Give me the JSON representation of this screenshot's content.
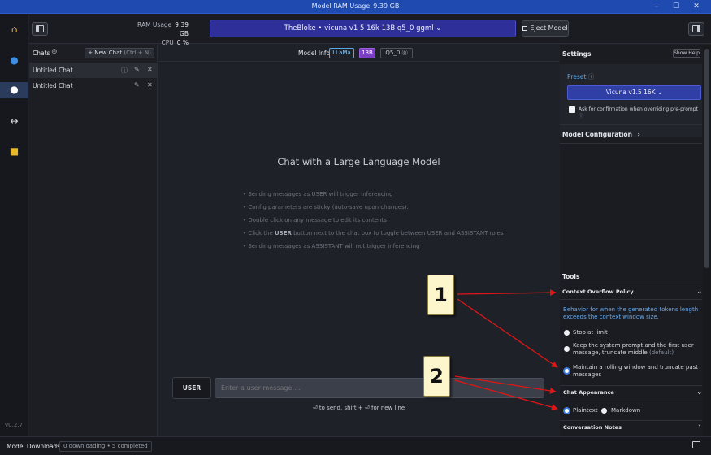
{
  "window": {
    "title": "Model RAM Usage",
    "ram": "9.39 GB"
  },
  "topbar": {
    "ram_label": "RAM Usage",
    "ram_value": "9.39 GB",
    "cpu_label": "CPU",
    "cpu_value": "0 %",
    "model_name": "TheBloke • vicuna v1 5 16k 13B q5_0 ggml",
    "eject_label": "Eject Model"
  },
  "nav": {
    "items": [
      "home-icon",
      "search-icon",
      "chat-icon",
      "arrows-icon",
      "folder-icon"
    ],
    "version": "v0.2.7"
  },
  "chats": {
    "title": "Chats",
    "new_chat": "+ New Chat",
    "new_chat_shortcut": "(Ctrl + N)",
    "items": [
      {
        "label": "Untitled Chat"
      },
      {
        "label": "Untitled Chat"
      }
    ]
  },
  "model_info": {
    "label": "Model Info",
    "arch": "LLaMa",
    "size": "13B",
    "quant": "Q5_0"
  },
  "main": {
    "title": "Chat with a Large Language Model",
    "tips": [
      "• Sending messages as USER will trigger inferencing",
      "• Config parameters are sticky (auto-save upon changes).",
      "• Double click on any message to edit its contents",
      "• Sending messages as ASSISTANT will not trigger inferencing"
    ],
    "tip4_prefix": "• Click the ",
    "tip4_bold": "USER",
    "tip4_suffix": " button next to the chat box to toggle between USER and ASSISTANT roles",
    "role_button": "USER",
    "input_placeholder": "Enter a user message ...",
    "hint": "⏎ to send, shift + ⏎ for new line"
  },
  "settings": {
    "title": "Settings",
    "show_help": "Show Help",
    "preset_label": "Preset",
    "preset_value": "Vicuna v1.5 16K",
    "confirm_label": "Ask for confirmation when overriding pre-prompt",
    "model_config": "Model Configuration",
    "tools": "Tools",
    "overflow_title": "Context Overflow Policy",
    "overflow_desc": "Behavior for when the generated tokens length exceeds the context window size.",
    "overflow_options": [
      {
        "label": "Stop at limit"
      },
      {
        "label": "Keep the system prompt and the first user message, truncate middle",
        "suffix": "(default)"
      },
      {
        "label": "Maintain a rolling window and truncate past messages"
      }
    ],
    "appearance_title": "Chat Appearance",
    "appearance_options": [
      "Plaintext",
      "Markdown"
    ],
    "conversation_notes": "Conversation Notes"
  },
  "statusbar": {
    "downloads": "Model Downloads",
    "status": "0 downloading • 5 completed"
  },
  "callouts": [
    "1",
    "2"
  ],
  "colors": {
    "accent": "#2f3fa6",
    "titlebar": "#1f4bb0",
    "arrow": "#e01616"
  }
}
